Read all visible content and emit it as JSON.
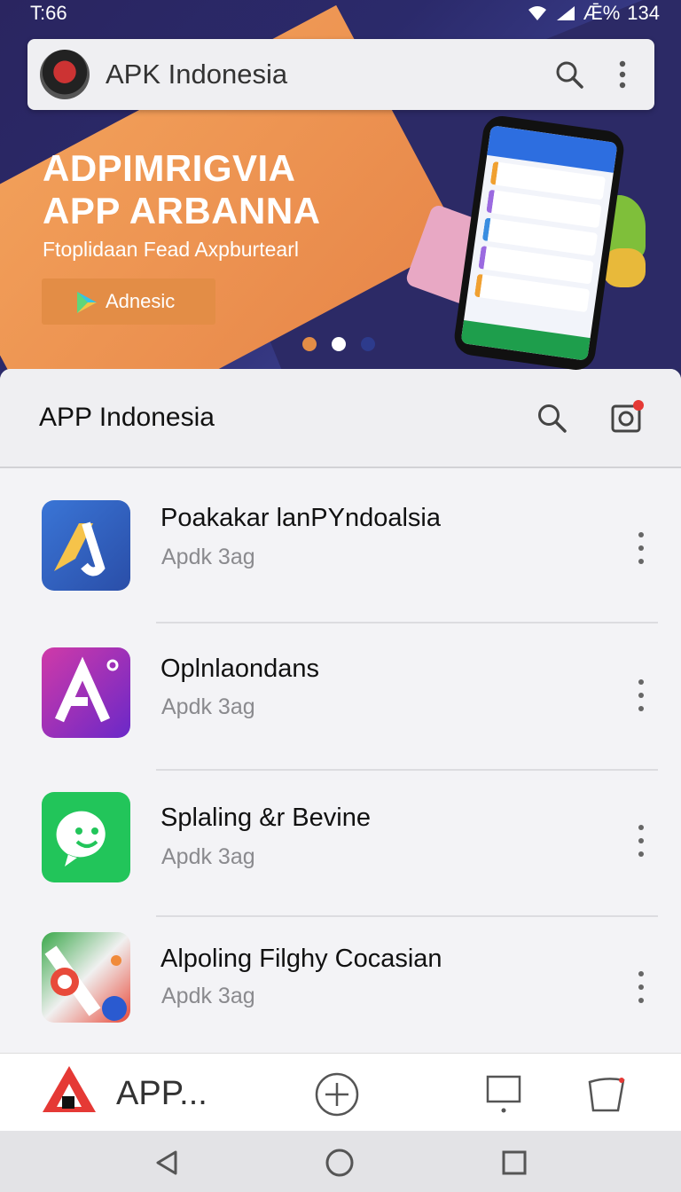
{
  "status_bar": {
    "time": "T:66",
    "right_text": "Ǣ%",
    "battery": "134"
  },
  "search_bar": {
    "title": "APK Indonesia",
    "search_icon": "search-icon",
    "menu_icon": "more-vert-icon"
  },
  "hero": {
    "title_line1": "ADPIMRIGVIA",
    "title_line2": "APP ARBANNA",
    "subtitle": "Ftoplidaan Fead Axpburtearl",
    "button_label": "Adnesic",
    "carousel": {
      "count": 3,
      "active": 1
    },
    "colors": {
      "accent": "#e38d46",
      "background": "#2b2a6b"
    }
  },
  "panel": {
    "title": "APP Indonesia",
    "search_icon": "search-icon",
    "camera_icon": "camera-icon"
  },
  "apps": [
    {
      "name": "Poakakar lanPYndoalsia",
      "subtitle": "Apdk 3ag",
      "icon": "blue-app-icon"
    },
    {
      "name": "Oplnlaondans",
      "subtitle": "Apdk 3ag",
      "icon": "purple-app-icon"
    },
    {
      "name": "Splaling &r Bevine",
      "subtitle": "Apdk 3ag",
      "icon": "green-chat-app-icon"
    },
    {
      "name": "Alpoling Filghy Cocasian",
      "subtitle": "Apdk 3ag",
      "icon": "maps-app-icon"
    }
  ],
  "bottom_nav": {
    "label": "APP...",
    "add_icon": "add-circle-icon",
    "screen_icon": "monitor-icon",
    "bag_icon": "bag-icon"
  },
  "system_nav": {
    "back": "back-icon",
    "home": "home-icon",
    "recents": "recents-icon"
  }
}
